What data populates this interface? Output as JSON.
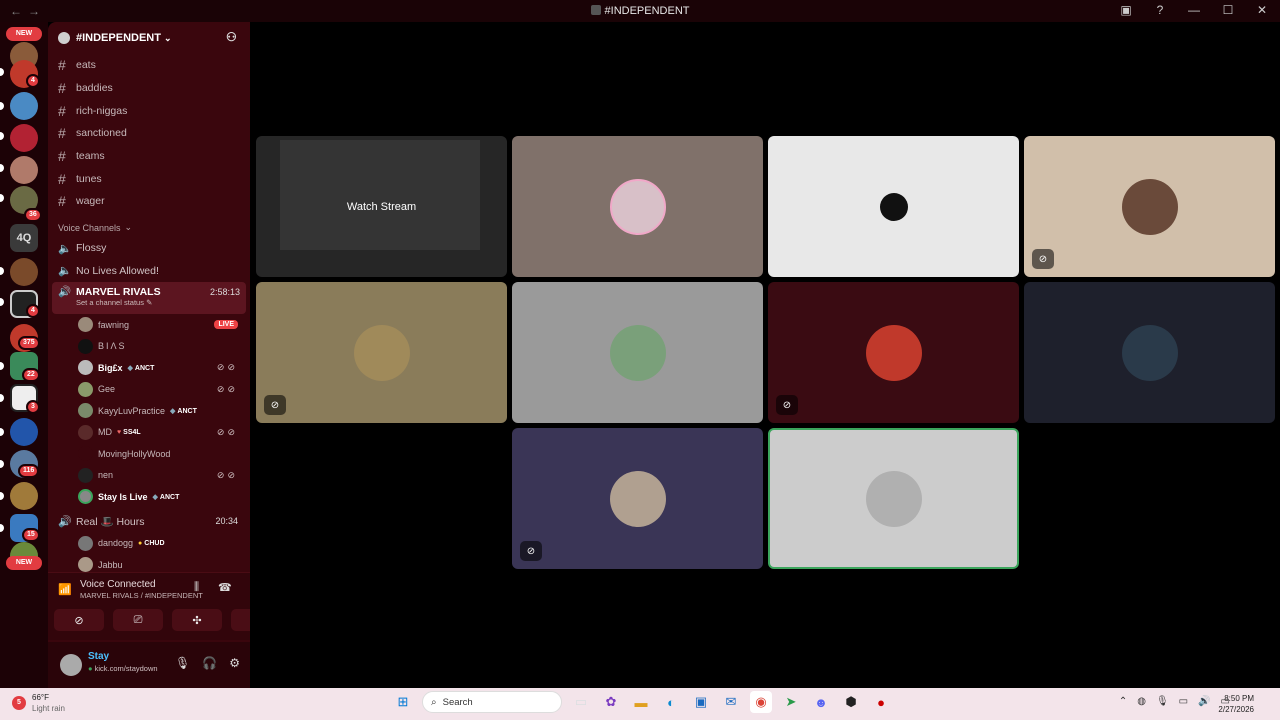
{
  "window": {
    "title": "#INDEPENDENT"
  },
  "rail": {
    "new_label": "NEW",
    "bottom_new_label": "NEW",
    "text_server": "4Q",
    "badges": [
      "4",
      "36",
      "4",
      "375",
      "22",
      "3",
      "116",
      "15"
    ]
  },
  "guild": {
    "name": "#INDEPENDENT"
  },
  "channels": [
    {
      "name": "eats"
    },
    {
      "name": "baddies"
    },
    {
      "name": "rich-niggas"
    },
    {
      "name": "sanctioned"
    },
    {
      "name": "teams"
    },
    {
      "name": "tunes"
    },
    {
      "name": "wager"
    }
  ],
  "voice_category": "Voice Channels",
  "voice_channels": [
    {
      "name": "Flossy"
    },
    {
      "name": "No Lives Allowed!"
    }
  ],
  "active_voice": {
    "name": "MARVEL RIVALS",
    "timer": "2:58:13",
    "status": "Set a channel status"
  },
  "members": [
    {
      "name": "fawning",
      "live": "LIVE"
    },
    {
      "name": "BIΛS"
    },
    {
      "name": "Big£x",
      "tag": "ANCT"
    },
    {
      "name": "Gee"
    },
    {
      "name": "KayyLuvPractice",
      "tag": "ANCT"
    },
    {
      "name": "MD",
      "tag": "SS4L"
    },
    {
      "name": "MovingHollyWood"
    },
    {
      "name": "nen"
    },
    {
      "name": "Stay Is Live",
      "tag": "ANCT"
    }
  ],
  "second_voice": {
    "name": "Real 🎩 Hours",
    "timer": "20:34"
  },
  "second_members": [
    {
      "name": "dandogg",
      "tag": "CHUD"
    },
    {
      "name": "Jabbu"
    }
  ],
  "voice_panel": {
    "title": "Voice Connected",
    "subtitle": "MARVEL RIVALS / #INDEPENDENT"
  },
  "user_panel": {
    "name": "Stay",
    "status": "kick.com/staydown"
  },
  "stage": {
    "watch_label": "Watch Stream"
  },
  "colors": {
    "accent": "#e23c41",
    "sidebar": "#3a060d",
    "rail": "#1c0206"
  },
  "taskbar": {
    "weather_temp": "66°F",
    "weather_desc": "Light rain",
    "weather_badge": "5",
    "search_placeholder": "Search",
    "time": "8:50 PM",
    "date": "2/27/2026"
  }
}
